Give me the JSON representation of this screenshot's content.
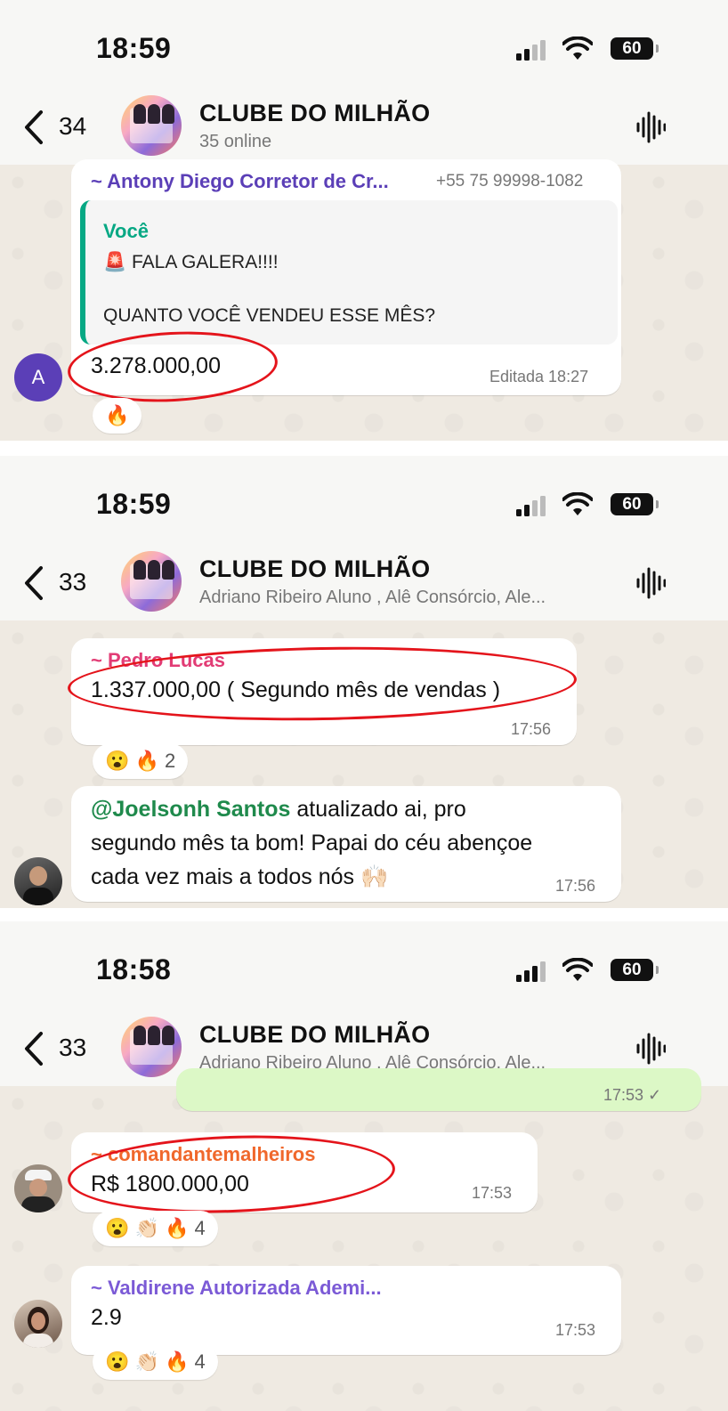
{
  "panels": [
    {
      "status_time": "18:59",
      "battery": "60",
      "back_count": "34",
      "title": "CLUBE DO MILHÃO",
      "subtitle": "35 online",
      "sender": "~ Antony Diego Corretor de Cr...",
      "phone": "+55 75 99998-1082",
      "quote_author": "Você",
      "quote_line1": "🚨 FALA GALERA!!!!",
      "quote_line2": "QUANTO VOCÊ VENDEU ESSE MÊS?",
      "message": "3.278.000,00",
      "meta": "Editada 18:27",
      "reaction": "🔥",
      "avatar_letter": "A"
    },
    {
      "status_time": "18:59",
      "battery": "60",
      "back_count": "33",
      "title": "CLUBE DO MILHÃO",
      "subtitle": "Adriano Ribeiro Aluno , Alê Consórcio, Ale...",
      "sender": "~ Pedro Lucas",
      "message": "1.337.000,00 ( Segundo mês de vendas )",
      "time": "17:56",
      "reactions": "😮 🔥 2",
      "mention": "@Joelsonh Santos",
      "msg2_line1": " atualizado ai, pro",
      "msg2_line2": "segundo mês ta bom! Papai do céu abençoe",
      "msg2_line3": "cada vez mais a todos nós 🙌🏻",
      "time2": "17:56"
    },
    {
      "status_time": "18:58",
      "battery": "60",
      "back_count": "33",
      "title": "CLUBE DO MILHÃO",
      "subtitle": "Adriano Ribeiro Aluno , Alê Consórcio, Ale...",
      "out_time": "17:53 ✓",
      "sender": "~ comandantemalheiros",
      "message": "R$ 1800.000,00",
      "time": "17:53",
      "reactions": "😮 👏🏻 🔥 4",
      "sender2": "~ Valdirene Autorizada Ademi...",
      "message2": "2.9",
      "time2": "17:53",
      "reactions2": "😮 👏🏻 🔥 4"
    }
  ],
  "colors": {
    "header_bg": "#f7f7f5",
    "chat_bg": "#efeae2",
    "sender1": "#5b3fb7",
    "quote_author": "#06a884",
    "sender2": "#e23c75",
    "mention": "#1f8a4c",
    "sender3": "#f0682c",
    "sender4": "#7b5ad6",
    "highlight_ring": "#e4141b"
  }
}
